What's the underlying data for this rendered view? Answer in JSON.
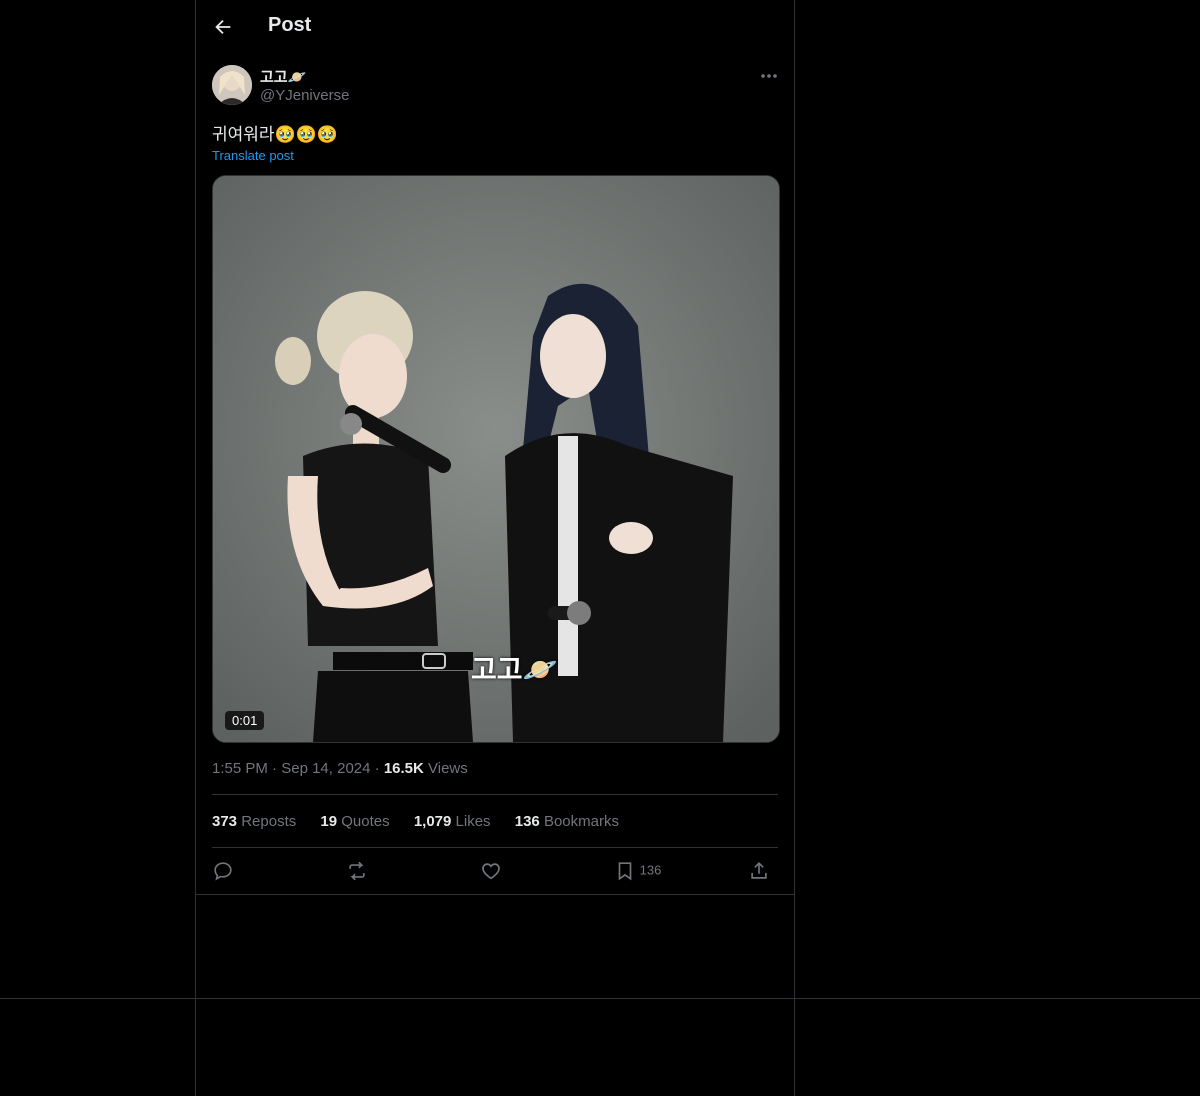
{
  "header": {
    "title": "Post"
  },
  "post": {
    "display_name": "고고🪐",
    "handle": "@YJeniverse",
    "text": "귀여워라🥹🥹🥹",
    "translate_label": "Translate post",
    "video": {
      "duration": "0:01",
      "caption": "고고🪐"
    },
    "time": "1:55 PM",
    "date": "Sep 14, 2024",
    "views_count": "16.5K",
    "views_label": "Views"
  },
  "stats": {
    "reposts_count": "373",
    "reposts_label": "Reposts",
    "quotes_count": "19",
    "quotes_label": "Quotes",
    "likes_count": "1,079",
    "likes_label": "Likes",
    "bookmarks_count": "136",
    "bookmarks_label": "Bookmarks"
  },
  "actions": {
    "bookmark_count": "136"
  },
  "icons": [
    "back-arrow-icon",
    "more-icon",
    "reply-icon",
    "repost-icon",
    "like-icon",
    "bookmark-icon",
    "share-icon"
  ]
}
